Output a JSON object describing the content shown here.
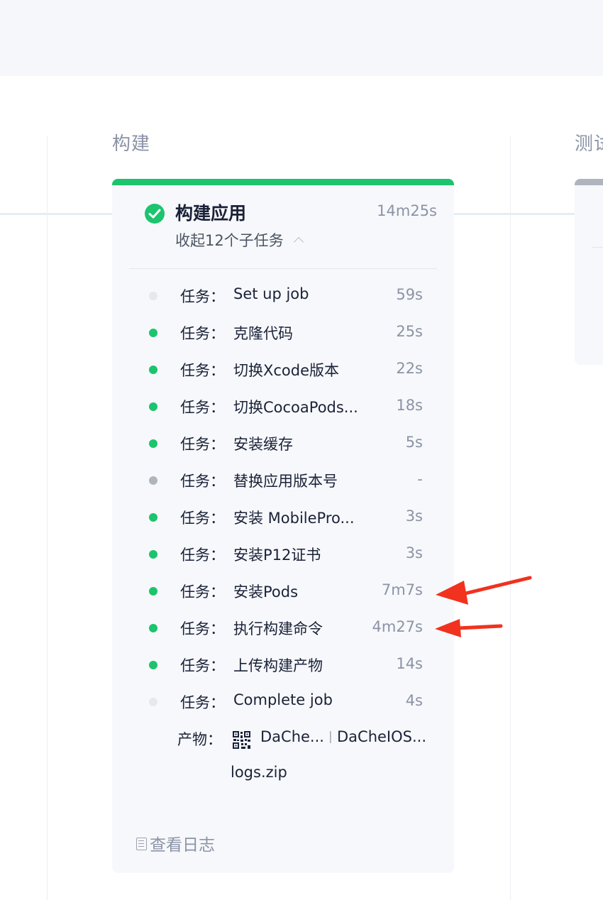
{
  "colors": {
    "success": "#1bc46d",
    "skipped": "#b0b4bd",
    "pending": "#e6e8ec",
    "annotation_arrow": "#f0321e"
  },
  "stages": {
    "build_title": "构建",
    "test_title": "测试"
  },
  "job": {
    "title": "构建应用",
    "duration": "14m25s",
    "status": "success",
    "collapse_label": "收起12个子任务",
    "tasks": [
      {
        "prefix": "任务：",
        "name": "Set up job",
        "time": "59s",
        "status": "pending"
      },
      {
        "prefix": "任务：",
        "name": "克隆代码",
        "time": "25s",
        "status": "success"
      },
      {
        "prefix": "任务：",
        "name": "切换Xcode版本",
        "time": "22s",
        "status": "success"
      },
      {
        "prefix": "任务：",
        "name": "切换CocoaPods...",
        "time": "18s",
        "status": "success"
      },
      {
        "prefix": "任务：",
        "name": "安装缓存",
        "time": "5s",
        "status": "success"
      },
      {
        "prefix": "任务：",
        "name": "替换应用版本号",
        "time": "-",
        "status": "skipped"
      },
      {
        "prefix": "任务：",
        "name": "安装 MobilePro...",
        "time": "3s",
        "status": "success"
      },
      {
        "prefix": "任务：",
        "name": "安装P12证书",
        "time": "3s",
        "status": "success"
      },
      {
        "prefix": "任务：",
        "name": "安装Pods",
        "time": "7m7s",
        "status": "success"
      },
      {
        "prefix": "任务：",
        "name": "执行构建命令",
        "time": "4m27s",
        "status": "success"
      },
      {
        "prefix": "任务：",
        "name": "上传构建产物",
        "time": "14s",
        "status": "success"
      },
      {
        "prefix": "任务：",
        "name": "Complete job",
        "time": "4s",
        "status": "pending"
      }
    ],
    "artifacts_label": "产物：",
    "artifacts": [
      "DaChe...",
      "DaCheIOS...",
      "logs.zip"
    ],
    "artifact_separator": "|",
    "view_logs_label": "查看日志"
  },
  "icons": {
    "status": "check-circle-icon",
    "collapse": "chevron-up-icon",
    "artifact_qr": "qr-code-icon",
    "logs": "document-icon"
  }
}
